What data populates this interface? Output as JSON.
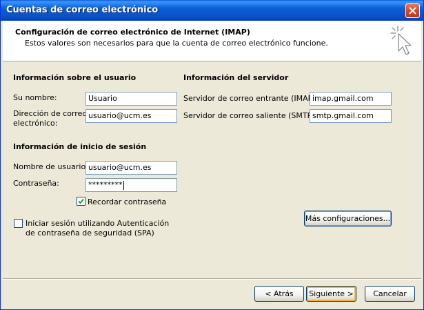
{
  "window": {
    "title": "Cuentas de correo electrónico"
  },
  "header": {
    "title": "Configuración de correo electrónico de Internet (IMAP)",
    "description": "Estos valores son necesarios para que la cuenta de correo electrónico funcione."
  },
  "user_info": {
    "heading": "Información sobre el usuario",
    "name_label": "Su nombre:",
    "name_value": "Usuario",
    "email_label_line1": "Dirección de correo",
    "email_label_line2": "electrónico:",
    "email_value": "usuario@ucm.es"
  },
  "server_info": {
    "heading": "Información del servidor",
    "incoming_label": "Servidor de correo entrante (IMAP):",
    "incoming_value": "imap.gmail.com",
    "outgoing_label": "Servidor de correo saliente (SMTP):",
    "outgoing_value": "smtp.gmail.com"
  },
  "login_info": {
    "heading": "Información de inicio de sesión",
    "username_label": "Nombre de usuario:",
    "username_value": "usuario@ucm.es",
    "password_label": "Contraseña:",
    "password_value": "*********",
    "remember_label": "Recordar contraseña",
    "remember_checked": true,
    "spa_label_line1": "Iniciar sesión utilizando Autenticación",
    "spa_label_line2": "de contraseña de seguridad (SPA)",
    "spa_checked": false
  },
  "buttons": {
    "more_settings": "Más configuraciones...",
    "back": "< Atrás",
    "next": "Siguiente >",
    "cancel": "Cancelar"
  },
  "colors": {
    "titlebar": "#0a5fd6",
    "dialog_bg": "#ece9d8",
    "input_border": "#7f9db9",
    "checkmark": "#21a121"
  }
}
